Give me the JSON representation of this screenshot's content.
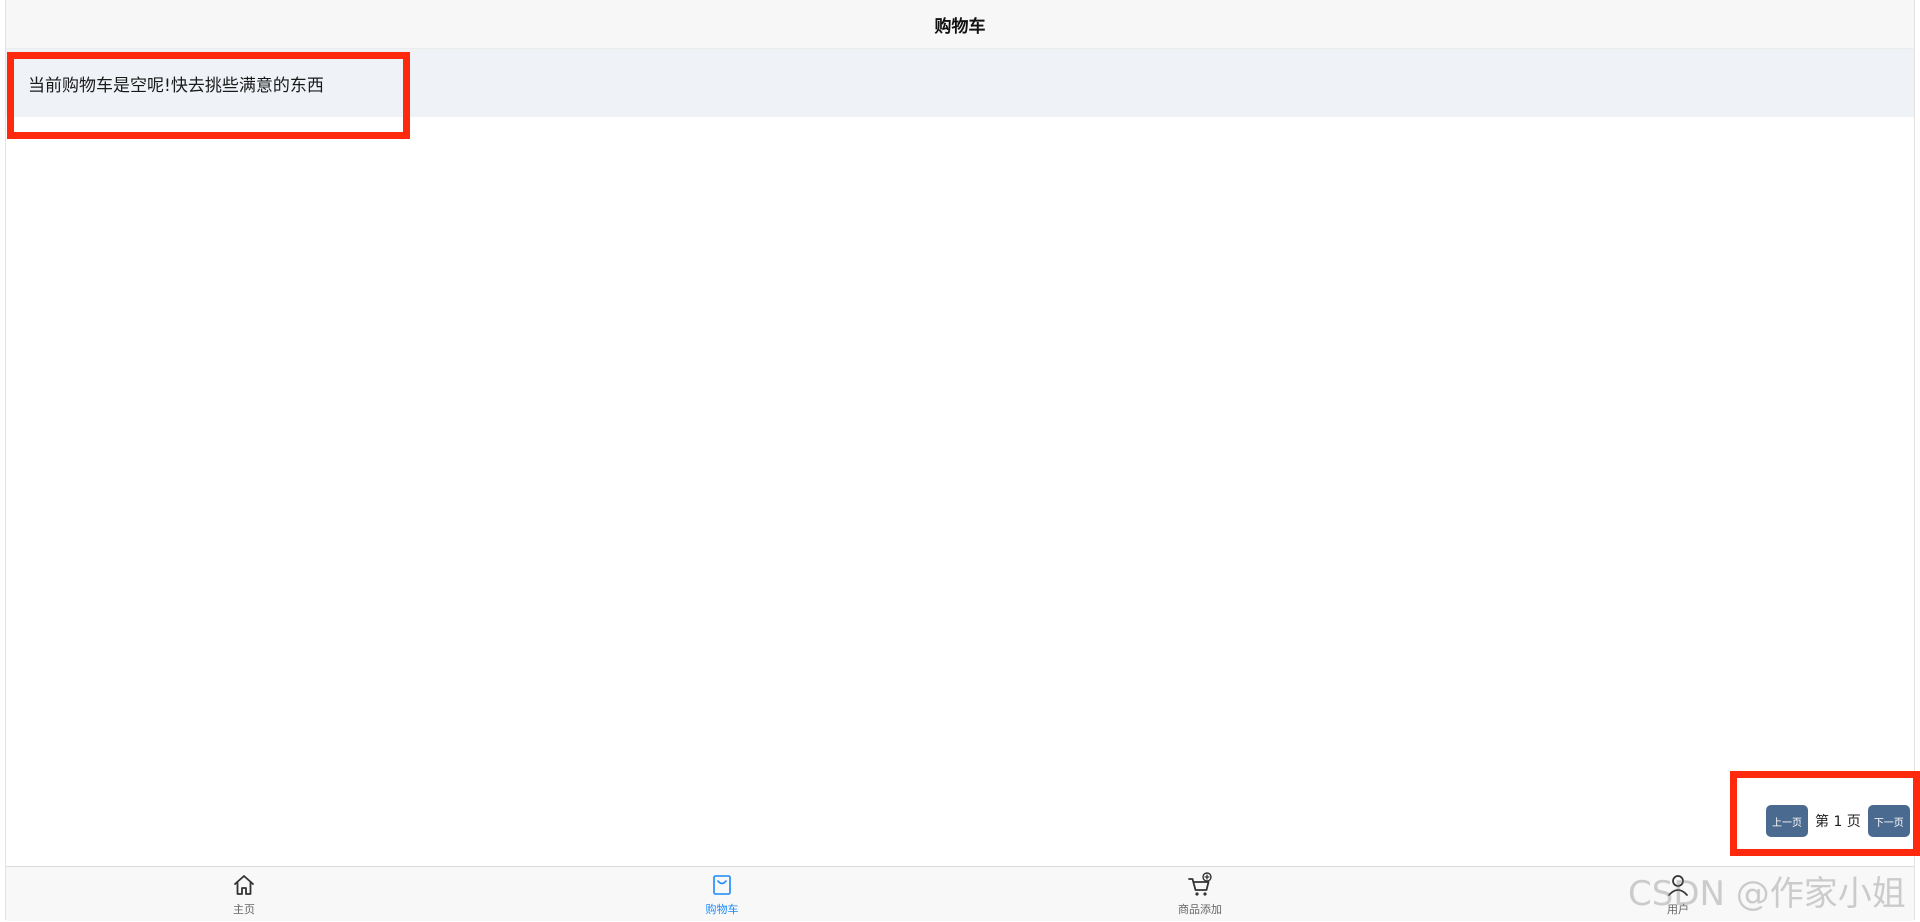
{
  "header": {
    "title": "购物车"
  },
  "cart": {
    "empty_message": "当前购物车是空呢!快去挑些满意的东西"
  },
  "pagination": {
    "prev_label": "上一页",
    "page_info": "第 1 页",
    "next_label": "下一页"
  },
  "tabbar": {
    "items": [
      {
        "label": "主页",
        "icon": "home-icon",
        "active": false
      },
      {
        "label": "购物车",
        "icon": "shopping-bag-icon",
        "active": true
      },
      {
        "label": "商品添加",
        "icon": "cart-add-icon",
        "active": false
      },
      {
        "label": "用户",
        "icon": "user-icon",
        "active": false
      }
    ]
  },
  "colors": {
    "accent": "#1989fa",
    "pager_button": "#4b6a8f",
    "highlight_border": "#ff2a0e"
  },
  "watermark": "CSDN @作家小姐"
}
